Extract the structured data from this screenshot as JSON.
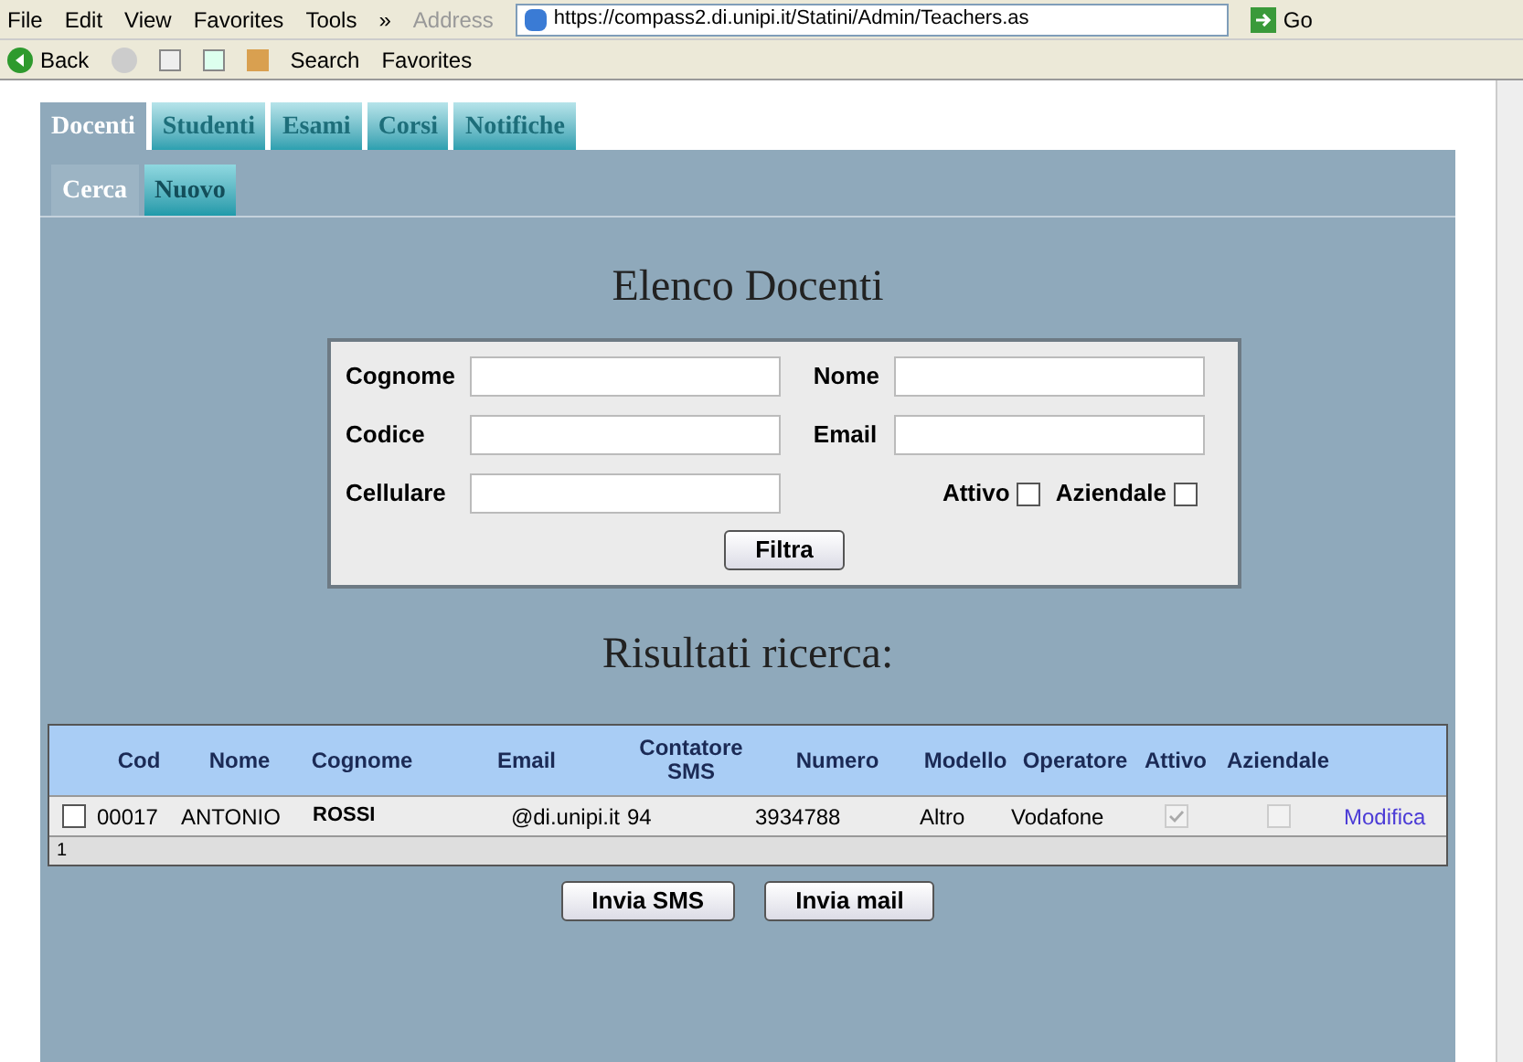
{
  "menu": [
    "File",
    "Edit",
    "View",
    "Favorites",
    "Tools",
    "»"
  ],
  "address": {
    "label": "Address",
    "url": "https://compass2.di.unipi.it/Statini/Admin/Teachers.as",
    "go": "Go"
  },
  "toolbar": {
    "back": "Back",
    "search": "Search",
    "favorites": "Favorites"
  },
  "tabs": [
    {
      "label": "Docenti",
      "selected": true
    },
    {
      "label": "Studenti",
      "selected": false
    },
    {
      "label": "Esami",
      "selected": false
    },
    {
      "label": "Corsi",
      "selected": false
    },
    {
      "label": "Notifiche",
      "selected": false
    }
  ],
  "subtabs": [
    {
      "label": "Cerca",
      "selected": true
    },
    {
      "label": "Nuovo",
      "selected": false
    }
  ],
  "title": "Elenco Docenti",
  "filters": {
    "cognome": "Cognome",
    "nome": "Nome",
    "codice": "Codice",
    "email": "Email",
    "cellulare": "Cellulare",
    "attivo": {
      "label": "Attivo",
      "checked": false
    },
    "aziendale": {
      "label": "Aziendale",
      "checked": false
    },
    "button": "Filtra"
  },
  "results_title": "Risultati ricerca:",
  "table": {
    "columns": [
      "Cod",
      "Nome",
      "Cognome",
      "Email",
      "Contatore SMS",
      "Numero",
      "Modello",
      "Operatore",
      "Attivo",
      "Aziendale"
    ],
    "rows": [
      {
        "selected": false,
        "cod": "00017",
        "nome": "ANTONIO",
        "cognome": "ROSSI",
        "email": "@di.unipi.it",
        "contatore": "94",
        "numero": "3934788",
        "modello": "Altro",
        "operatore": "Vodafone",
        "attivo": true,
        "aziendale": false,
        "link": "Modifica"
      }
    ],
    "pager": "1"
  },
  "buttons": [
    "Invia SMS",
    "Invia mail"
  ]
}
